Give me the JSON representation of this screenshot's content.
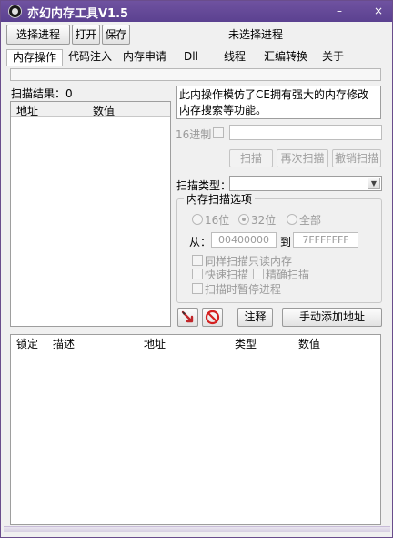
{
  "window": {
    "title": "亦幻内存工具V1.5",
    "minimize_label": "–",
    "close_label": "×"
  },
  "toolbar": {
    "select_process": "选择进程",
    "open": "打开",
    "save": "保存",
    "status": "未选择进程"
  },
  "tabs": [
    {
      "label": "内存操作",
      "active": true
    },
    {
      "label": "代码注入"
    },
    {
      "label": "内存申请"
    },
    {
      "label": "Dll"
    },
    {
      "label": "线程"
    },
    {
      "label": "汇编转换"
    },
    {
      "label": "关于"
    }
  ],
  "results": {
    "label": "扫描结果：0",
    "columns": [
      "地址",
      "数值"
    ]
  },
  "info": {
    "line1": "此内操作模仿了CE拥有强大的内存修改",
    "line2": "内存搜索等功能。"
  },
  "scan": {
    "hex_label": "16进制",
    "scan": "扫描",
    "rescan": "再次扫描",
    "undo_scan": "撤销扫描",
    "type_label": "扫描类型：",
    "options_title": "内存扫描选项",
    "bits16": "16位",
    "bits32": "32位",
    "all": "全部",
    "from_label": "从：",
    "from_value": "00400000",
    "to_label": "到",
    "to_value": "7FFFFFFF",
    "readonly": "同样扫描只读内存",
    "fast": "快速扫描",
    "exact": "精确扫描",
    "pause": "扫描时暂停进程"
  },
  "actions": {
    "note": "注释",
    "manual_add": "手动添加地址"
  },
  "address_list": {
    "columns": [
      "锁定",
      "描述",
      "地址",
      "类型",
      "数值"
    ]
  },
  "colors": {
    "titlebar": "#5b4190",
    "accent": "#6a4d8c"
  }
}
